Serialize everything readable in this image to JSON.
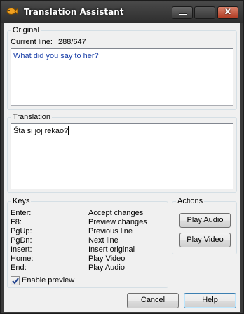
{
  "window": {
    "title": "Translation Assistant",
    "close_glyph": "x"
  },
  "original": {
    "group_label": "Original",
    "current_line_label": "Current line:",
    "current_line_value": "288/647",
    "text": "What did you say to her?"
  },
  "translation": {
    "group_label": "Translation",
    "text": "Šta si joj rekao?"
  },
  "keys": {
    "group_label": "Keys",
    "rows": [
      {
        "key": "Enter:",
        "action": "Accept changes"
      },
      {
        "key": "F8:",
        "action": "Preview changes"
      },
      {
        "key": "PgUp:",
        "action": "Previous line"
      },
      {
        "key": "PgDn:",
        "action": "Next line"
      },
      {
        "key": "Insert:",
        "action": "Insert original"
      },
      {
        "key": "Home:",
        "action": "Play Video"
      },
      {
        "key": "End:",
        "action": "Play Audio"
      }
    ],
    "enable_preview_label": "Enable preview",
    "enable_preview_checked": true
  },
  "actions": {
    "group_label": "Actions",
    "play_audio_label": "Play Audio",
    "play_video_label": "Play Video"
  },
  "footer": {
    "cancel_label": "Cancel",
    "help_label": "Help"
  },
  "colors": {
    "original_text": "#1a3fa8",
    "titlebar": "#3a3a3a",
    "close_button": "#c0472c"
  }
}
